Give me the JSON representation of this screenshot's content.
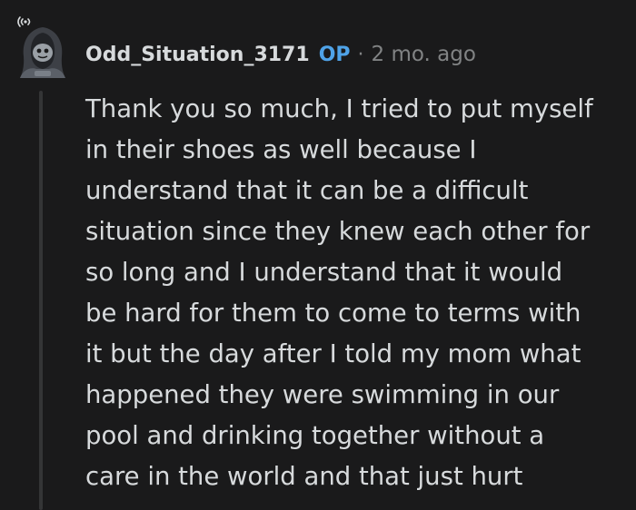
{
  "comment": {
    "author": "Odd_Situation_3171",
    "badge": "OP",
    "separator": "·",
    "timestamp": "2 mo. ago",
    "body_lines": [
      "Thank you so much, I tried to put myself",
      "in their shoes as well because I",
      "understand that it can be a difficult",
      "situation since they knew each other for",
      "so long and I understand that it would",
      "be hard for them to come to terms with",
      "it but the day after I told my mom what",
      "happened they were swimming in our",
      "pool and drinking together without a",
      "care in the world and that just hurt"
    ]
  },
  "colors": {
    "background": "#1a1a1b",
    "text": "#d7dadc",
    "muted": "#818384",
    "op_accent": "#4fa3e8",
    "thread_line": "#343536"
  },
  "icons": {
    "avatar": "snoo-avatar-icon"
  }
}
